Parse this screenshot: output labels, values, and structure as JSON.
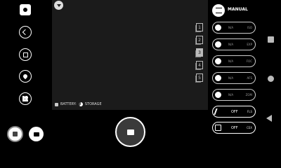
{
  "left_toolbar": {
    "buttons": [
      "settings-icon",
      "share-icon",
      "gallery-icon",
      "location-icon",
      "grid-icon"
    ]
  },
  "modes": {
    "photo": "camera-icon",
    "video": "video-icon"
  },
  "viewfinder": {
    "battery_label": "BATTERY:",
    "storage_label": "STORAGE",
    "tabs": [
      "1",
      "2",
      "3",
      "4",
      "5"
    ],
    "active_tab": "3"
  },
  "manual": {
    "label": "MANUAL"
  },
  "settings": [
    {
      "value": "N/A",
      "key": "ISO"
    },
    {
      "value": "N/A",
      "key": "EXP"
    },
    {
      "value": "N/A",
      "key": "FOC"
    },
    {
      "value": "N/A",
      "key": "AFS"
    },
    {
      "value": "N/A",
      "key": "ZOM"
    }
  ],
  "toggles": [
    {
      "value": "OFF",
      "key": "FLS"
    },
    {
      "value": "OFF",
      "key": "CEX"
    }
  ]
}
